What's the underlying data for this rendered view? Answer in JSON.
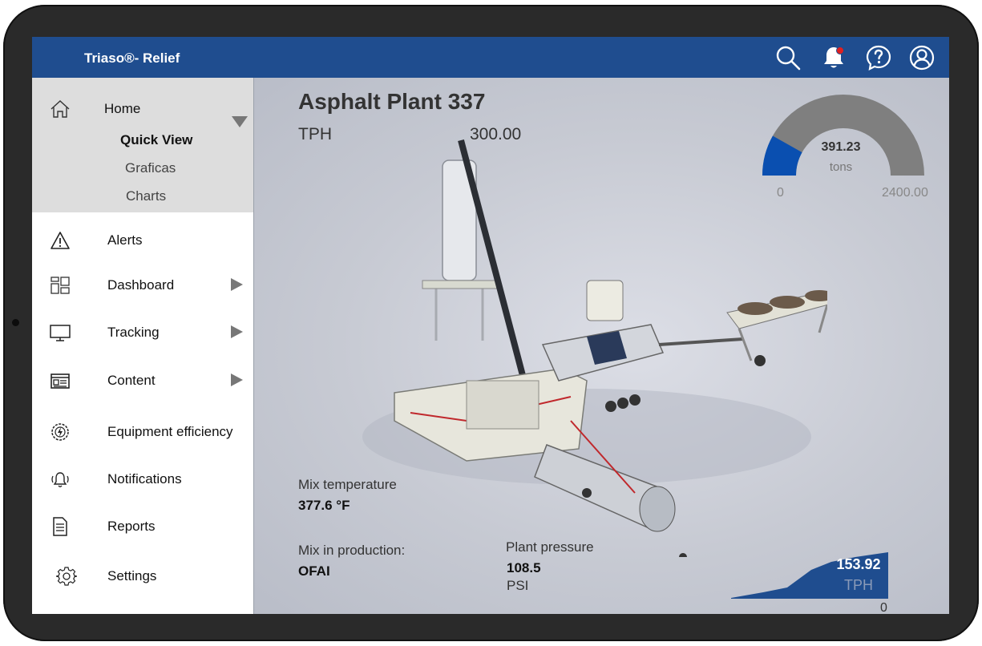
{
  "app": {
    "title": "Triaso®- Relief"
  },
  "topbar": {
    "icons": [
      "search-icon",
      "bell-icon",
      "help-icon",
      "user-icon"
    ],
    "notification_dot_color": "#e02020"
  },
  "sidebar": {
    "home": {
      "label": "Home",
      "icon": "home-icon",
      "subitems": [
        "Quick View",
        "Graficas",
        "Charts"
      ]
    },
    "items": [
      {
        "label": "Alerts",
        "icon": "warning-icon",
        "has_arrow": false
      },
      {
        "label": "Dashboard",
        "icon": "dashboard-icon",
        "has_arrow": true
      },
      {
        "label": "Tracking",
        "icon": "monitor-icon",
        "has_arrow": true
      },
      {
        "label": "Content",
        "icon": "content-card-icon",
        "has_arrow": true
      },
      {
        "label": "Equipment efficiency",
        "icon": "efficiency-gauge-icon",
        "has_arrow": false
      },
      {
        "label": "Notifications",
        "icon": "ringing-bell-icon",
        "has_arrow": false
      },
      {
        "label": "Reports",
        "icon": "document-icon",
        "has_arrow": false
      },
      {
        "label": "Settings",
        "icon": "gear-icon",
        "has_arrow": false
      }
    ]
  },
  "main": {
    "plant_title": "Asphalt Plant 337",
    "tph_label": "TPH",
    "tph_value": "300.00",
    "gauge": {
      "value": "391.23",
      "unit": "tons",
      "min": "0",
      "max": "2400.00",
      "fill_fraction": 0.163,
      "fill_color": "#0a4fb0",
      "track_color": "#7f7f7f"
    },
    "mix_temperature_label": "Mix temperature",
    "mix_temperature_value": "377.6 °F",
    "mix_production_label": "Mix in production:",
    "mix_production_value": "OFAI",
    "plant_pressure_label": "Plant pressure",
    "plant_pressure_value": "108.5",
    "plant_pressure_unit": "PSI",
    "sparkline": {
      "value": "153.92",
      "unit": "TPH",
      "zero_label": "0",
      "fill_color": "#1f4d8f"
    }
  },
  "colors": {
    "accent": "#1f4d8f",
    "sidebar_active_bg": "#dddddd"
  }
}
